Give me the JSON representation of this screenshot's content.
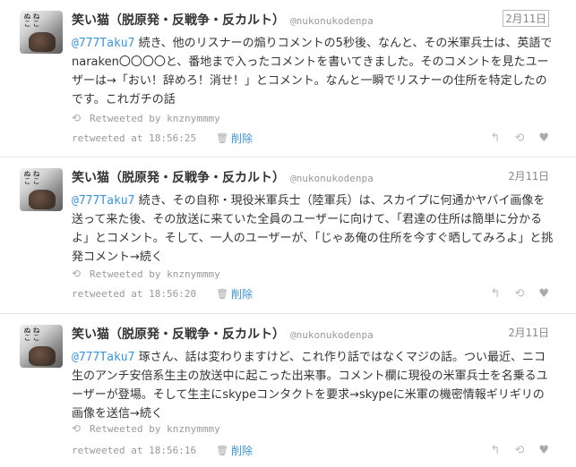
{
  "tweets": [
    {
      "name": "笑い猫（脱原発・反戦争・反カルト）",
      "handle": "@nukonukodenpa",
      "date": "2月11日",
      "mention": "@777Taku7",
      "text": "続き、他のリスナーの煽りコメントの5秒後、なんと、その米軍兵士は、英語でnaraken〇〇〇〇と、番地まで入ったコメントを書いてきました。そのコメントを見たユーザーは→「おい！辞めろ！消せ！」とコメント。なんと一瞬でリスナーの住所を特定したのです。これガチの話",
      "retweeted_by": "Retweeted by knznymmmy",
      "retweeted_at": "retweeted at 18:56:25",
      "delete_label": "削除"
    },
    {
      "name": "笑い猫（脱原発・反戦争・反カルト）",
      "handle": "@nukonukodenpa",
      "date": "2月11日",
      "mention": "@777Taku7",
      "text": "続き、その自称・現役米軍兵士（陸軍兵）は、スカイプに何通かヤバイ画像を送って来た後、その放送に来ていた全員のユーザーに向けて、「君達の住所は簡単に分かるよ」とコメント。そして、一人のユーザーが、「じゃあ俺の住所を今すぐ晒してみろよ」と挑発コメント→続く",
      "retweeted_by": "Retweeted by knznymmmy",
      "retweeted_at": "retweeted at 18:56:20",
      "delete_label": "削除"
    },
    {
      "name": "笑い猫（脱原発・反戦争・反カルト）",
      "handle": "@nukonukodenpa",
      "date": "2月11日",
      "mention": "@777Taku7",
      "text": "琢さん、話は変わりますけど、これ作り話ではなくマジの話。つい最近、ニコ生のアンチ安倍系生主の放送中に起こった出来事。コメント欄に現役の米軍兵士を名乗るユーザーが登場。そして生主にskypeコンタクトを要求→skypeに米軍の機密情報ギリギリの画像を送信→続く",
      "retweeted_by": "Retweeted by knznymmmy",
      "retweeted_at": "retweeted at 18:56:16",
      "delete_label": "削除"
    }
  ],
  "icons": {
    "avatar_text": "ねこぬこ",
    "retweet": "retweet-icon",
    "trash": "trash-icon",
    "reply": "reply-icon",
    "favorite": "heart-icon"
  },
  "colors": {
    "link": "#3b94d9",
    "muted": "#999999",
    "separator": "#e6e6e6"
  }
}
